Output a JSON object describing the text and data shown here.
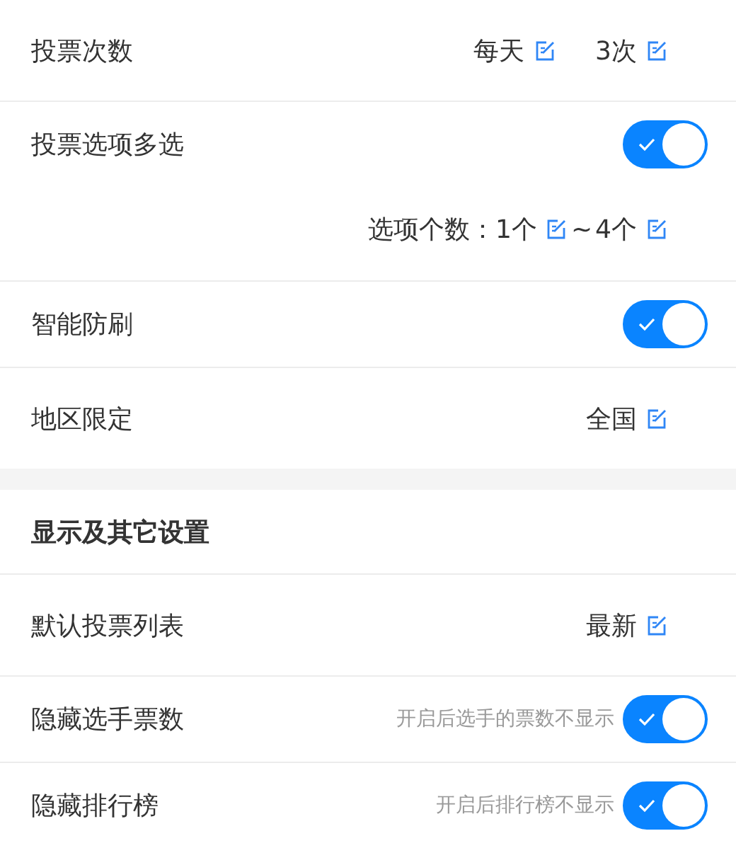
{
  "sections": [
    {
      "rows": [
        {
          "kind": "values",
          "label": "投票次数",
          "values": [
            "每天",
            "3次"
          ]
        },
        {
          "kind": "switch",
          "label": "投票选项多选",
          "on": true,
          "detail": {
            "prefix": "选项个数：",
            "values": [
              "1个",
              "4个"
            ],
            "separator": "~"
          }
        },
        {
          "kind": "switch",
          "label": "智能防刷",
          "on": true
        },
        {
          "kind": "values",
          "label": "地区限定",
          "values": [
            "全国"
          ]
        }
      ]
    },
    {
      "heading": "显示及其它设置",
      "rows": [
        {
          "kind": "values",
          "label": "默认投票列表",
          "values": [
            "最新"
          ]
        },
        {
          "kind": "switch",
          "label": "隐藏选手票数",
          "on": true,
          "hint": "开启后选手的票数不显示"
        },
        {
          "kind": "switch",
          "label": "隐藏排行榜",
          "on": true,
          "hint": "开启后排行榜不显示"
        }
      ]
    }
  ]
}
